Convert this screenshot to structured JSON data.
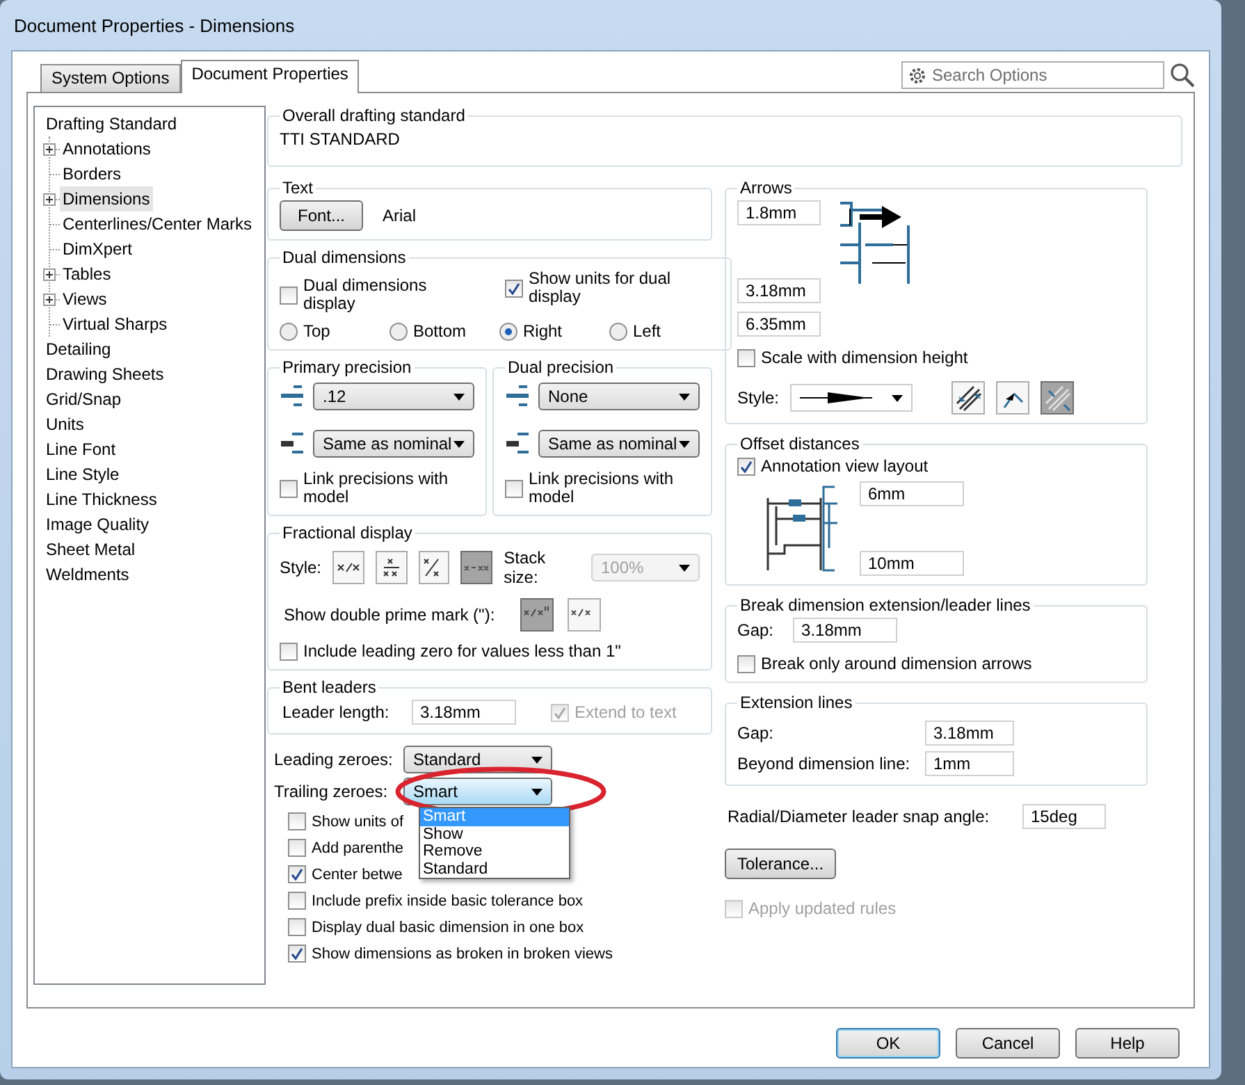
{
  "window": {
    "title": "Document Properties - Dimensions"
  },
  "tabs": [
    {
      "label": "System Options",
      "selected": false
    },
    {
      "label": "Document Properties",
      "selected": true
    }
  ],
  "search": {
    "placeholder": "Search Options"
  },
  "tree": [
    {
      "label": "Drafting Standard",
      "selected": false,
      "children": [
        {
          "label": "Annotations",
          "selected": false,
          "collapsible": true
        },
        {
          "label": "Borders",
          "selected": false,
          "collapsible": false
        },
        {
          "label": "Dimensions",
          "selected": true,
          "collapsible": true
        },
        {
          "label": "Centerlines/Center Marks",
          "selected": false,
          "collapsible": false
        },
        {
          "label": "DimXpert",
          "selected": false,
          "collapsible": false
        },
        {
          "label": "Tables",
          "selected": false,
          "collapsible": true
        },
        {
          "label": "Views",
          "selected": false,
          "collapsible": true
        },
        {
          "label": "Virtual Sharps",
          "selected": false,
          "collapsible": false
        }
      ]
    },
    {
      "label": "Detailing",
      "selected": false
    },
    {
      "label": "Drawing Sheets",
      "selected": false
    },
    {
      "label": "Grid/Snap",
      "selected": false
    },
    {
      "label": "Units",
      "selected": false
    },
    {
      "label": "Line Font",
      "selected": false
    },
    {
      "label": "Line Style",
      "selected": false
    },
    {
      "label": "Line Thickness",
      "selected": false
    },
    {
      "label": "Image Quality",
      "selected": false
    },
    {
      "label": "Sheet Metal",
      "selected": false
    },
    {
      "label": "Weldments",
      "selected": false
    }
  ],
  "overall_standard": {
    "label": "Overall drafting standard",
    "value": "TTI STANDARD"
  },
  "text": {
    "label": "Text",
    "font_button": "Font...",
    "font_name": "Arial"
  },
  "dual_dimensions": {
    "label": "Dual dimensions",
    "checkboxes": [
      {
        "label": "Dual dimensions display",
        "checked": false
      },
      {
        "label": "Show units for dual display",
        "checked": true
      }
    ],
    "radios": [
      {
        "label": "Top",
        "selected": false
      },
      {
        "label": "Bottom",
        "selected": false
      },
      {
        "label": "Right",
        "selected": true
      },
      {
        "label": "Left",
        "selected": false
      }
    ]
  },
  "primary_precision": {
    "label": "Primary precision",
    "value": ".12",
    "tolerance": "Same as nominal",
    "link": {
      "label": "Link precisions with model",
      "checked": false
    }
  },
  "dual_precision": {
    "label": "Dual precision",
    "value": "None",
    "tolerance": "Same as nominal",
    "link": {
      "label": "Link precisions with model",
      "checked": false
    }
  },
  "fractional_display": {
    "label": "Fractional display",
    "style_label": "Style:",
    "styles": [
      {
        "selected": false
      },
      {
        "selected": false
      },
      {
        "selected": false
      },
      {
        "selected": true
      }
    ],
    "stack_label": "Stack size:",
    "stack_value": "100%",
    "prime_label": "Show double prime mark (\"):",
    "primes": [
      {
        "selected": true
      },
      {
        "selected": false
      }
    ],
    "leading_zero": {
      "label": "Include leading zero for values less than 1\"",
      "checked": false
    }
  },
  "bent_leaders": {
    "label": "Bent leaders",
    "length_label": "Leader length:",
    "length_value": "3.18mm",
    "extend": {
      "label": "Extend to text",
      "checked": true,
      "disabled": true
    }
  },
  "leading_zeroes": {
    "label": "Leading zeroes:",
    "value": "Standard"
  },
  "trailing_zeroes": {
    "label": "Trailing zeroes:",
    "value": "Smart",
    "options": [
      {
        "label": "Smart",
        "selected": true
      },
      {
        "label": "Show",
        "selected": false
      },
      {
        "label": "Remove",
        "selected": false
      },
      {
        "label": "Standard",
        "selected": false
      }
    ]
  },
  "options": [
    {
      "label": "Show units of",
      "checked": false
    },
    {
      "label": "Add parenthe",
      "checked": false
    },
    {
      "label": "Center betwe",
      "checked": true
    },
    {
      "label": "Include prefix inside basic tolerance box",
      "checked": false
    },
    {
      "label": "Display dual basic dimension in one box",
      "checked": false
    },
    {
      "label": "Show dimensions as broken in broken views",
      "checked": true
    }
  ],
  "arrows": {
    "label": "Arrows",
    "fields": [
      "1.8mm",
      "3.18mm",
      "6.35mm"
    ],
    "scale": {
      "label": "Scale with dimension height",
      "checked": false
    },
    "style_label": "Style:",
    "placements": [
      {
        "selected": false
      },
      {
        "selected": false
      },
      {
        "selected": true
      }
    ]
  },
  "offset_distances": {
    "label": "Offset distances",
    "layout": {
      "label": "Annotation view layout",
      "checked": true
    },
    "fields": [
      "6mm",
      "10mm"
    ]
  },
  "break_lines": {
    "label": "Break dimension extension/leader lines",
    "gap_label": "Gap:",
    "gap_value": "3.18mm",
    "only_arrows": {
      "label": "Break only around dimension arrows",
      "checked": false
    }
  },
  "extension_lines": {
    "label": "Extension lines",
    "rows": [
      {
        "label": "Gap:",
        "value": "3.18mm"
      },
      {
        "label": "Beyond dimension line:",
        "value": "1mm"
      }
    ]
  },
  "snap_angle": {
    "label": "Radial/Diameter leader snap angle:",
    "value": "15deg"
  },
  "tolerance_button": "Tolerance...",
  "apply_rules": {
    "label": "Apply updated rules",
    "checked": false,
    "disabled": true
  },
  "buttons": [
    {
      "label": "OK",
      "default": true
    },
    {
      "label": "Cancel",
      "default": false
    },
    {
      "label": "Help",
      "default": false
    }
  ]
}
